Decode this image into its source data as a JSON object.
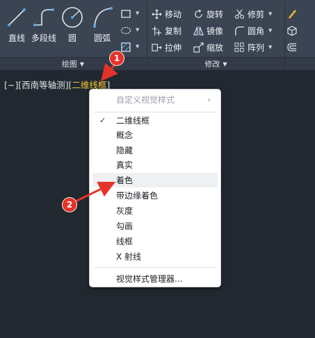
{
  "ribbon": {
    "draw": {
      "label": "绘图",
      "tools": [
        {
          "label": "直线",
          "icon": "line-icon"
        },
        {
          "label": "多段线",
          "icon": "polyline-icon"
        },
        {
          "label": "圆",
          "icon": "circle-icon"
        },
        {
          "label": "圆弧",
          "icon": "arc-icon"
        }
      ],
      "small_tools": [
        "rectangle-icon",
        "ellipse-icon",
        "hatch-icon"
      ]
    },
    "modify": {
      "label": "修改",
      "tools": [
        {
          "label": "移动",
          "icon": "move-icon"
        },
        {
          "label": "旋转",
          "icon": "rotate-icon"
        },
        {
          "label": "修剪",
          "icon": "trim-icon"
        },
        {
          "label": "复制",
          "icon": "copy-icon"
        },
        {
          "label": "镜像",
          "icon": "mirror-icon"
        },
        {
          "label": "圆角",
          "icon": "fillet-icon"
        },
        {
          "label": "拉伸",
          "icon": "stretch-icon"
        },
        {
          "label": "缩放",
          "icon": "scale-icon"
        },
        {
          "label": "阵列",
          "icon": "array-icon"
        }
      ],
      "extra_icons": [
        "erase-icon",
        "explode-icon",
        "offset-icon"
      ]
    }
  },
  "viewport": {
    "prefix": "[−][西南等轴测][",
    "style": "二维线框",
    "suffix": "]"
  },
  "context_menu": {
    "header": "自定义视觉样式",
    "items": [
      {
        "label": "二维线框",
        "checked": true
      },
      {
        "label": "概念"
      },
      {
        "label": "隐藏"
      },
      {
        "label": "真实"
      },
      {
        "label": "着色",
        "hover": true
      },
      {
        "label": "带边缘着色"
      },
      {
        "label": "灰度"
      },
      {
        "label": "勾画"
      },
      {
        "label": "线框"
      },
      {
        "label": "X 射线"
      }
    ],
    "footer": "视觉样式管理器..."
  },
  "annotations": {
    "badge1": "1",
    "badge2": "2"
  },
  "colors": {
    "background": "#212830",
    "ribbon": "#3b4453",
    "highlight": "#f2c430",
    "badge": "#e5332a"
  }
}
